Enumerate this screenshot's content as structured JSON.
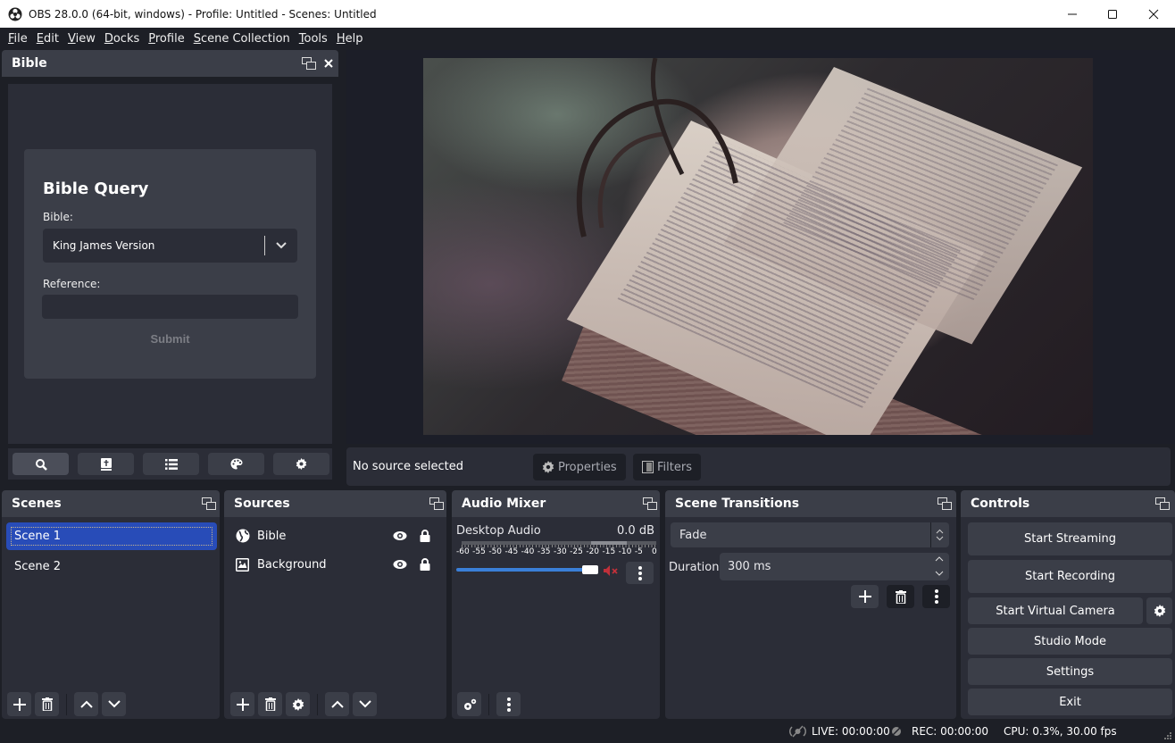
{
  "window": {
    "title": "OBS 28.0.0 (64-bit, windows) - Profile: Untitled - Scenes: Untitled",
    "controls": [
      "minimize-icon",
      "maximize-icon",
      "close-icon"
    ]
  },
  "menubar": {
    "items": [
      {
        "accel": "F",
        "rest": "ile"
      },
      {
        "accel": "E",
        "rest": "dit"
      },
      {
        "accel": "V",
        "rest": "iew"
      },
      {
        "accel": "D",
        "rest": "ocks"
      },
      {
        "accel": "P",
        "rest": "rofile"
      },
      {
        "accel": "S",
        "rest": "cene Collection"
      },
      {
        "accel": "T",
        "rest": "ools"
      },
      {
        "accel": "H",
        "rest": "elp"
      }
    ]
  },
  "bible_dock": {
    "title": "Bible",
    "query": {
      "title": "Bible Query",
      "bible_label": "Bible:",
      "bible_selected": "King James Version",
      "reference_label": "Reference:",
      "reference_value": "",
      "submit_label": "Submit"
    },
    "toolbar": [
      "search-icon",
      "bible-icon",
      "list-icon",
      "palette-icon",
      "gear-icon"
    ]
  },
  "preview": {
    "image_description": "Open old bible book with basket handle, dim moody lighting"
  },
  "source_bar": {
    "status": "No source selected",
    "properties_label": "Properties",
    "filters_label": "Filters"
  },
  "scenes": {
    "title": "Scenes",
    "items": [
      {
        "name": "Scene 1",
        "selected": true
      },
      {
        "name": "Scene 2",
        "selected": false
      }
    ]
  },
  "sources": {
    "title": "Sources",
    "items": [
      {
        "name": "Bible",
        "icon": "browser-globe-icon",
        "visible": true,
        "locked": true
      },
      {
        "name": "Background",
        "icon": "image-icon",
        "visible": true,
        "locked": true
      }
    ]
  },
  "audio_mixer": {
    "title": "Audio Mixer",
    "channels": [
      {
        "name": "Desktop Audio",
        "level": "0.0 dB",
        "volume_fraction": 1.0,
        "muted": true
      }
    ],
    "scale": [
      "-60",
      "-55",
      "-50",
      "-45",
      "-40",
      "-35",
      "-30",
      "-25",
      "-20",
      "-15",
      "-10",
      "-5",
      "0"
    ]
  },
  "scene_transitions": {
    "title": "Scene Transitions",
    "transition": "Fade",
    "duration_label": "Duration",
    "duration_value": "300 ms"
  },
  "controls": {
    "title": "Controls",
    "start_streaming": "Start Streaming",
    "start_recording": "Start Recording",
    "start_virtual_camera": "Start Virtual Camera",
    "studio_mode": "Studio Mode",
    "settings": "Settings",
    "exit": "Exit"
  },
  "statusbar": {
    "live": "LIVE: 00:00:00",
    "rec": "REC: 00:00:00",
    "cpu": "CPU: 0.3%, 30.00 fps"
  },
  "colors": {
    "accent_selection": "#284cb8",
    "volume_bar": "#3a7fd8",
    "mute_icon": "#c0303a",
    "dock_header": "#3b3e48",
    "panel_bg": "#2b2d37"
  }
}
